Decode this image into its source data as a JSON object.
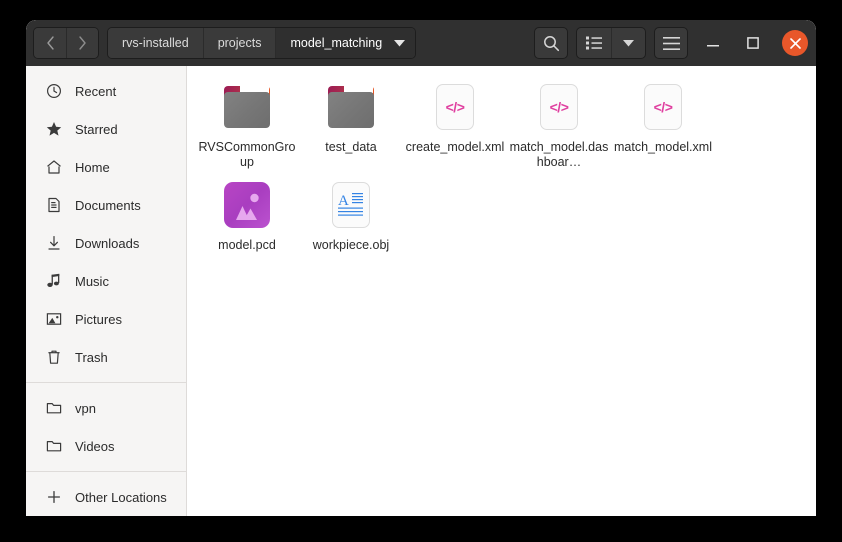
{
  "window": {
    "header": {
      "nav": [
        {
          "name": "back-button",
          "glyph": "‹"
        },
        {
          "name": "forward-button",
          "glyph": "›"
        }
      ],
      "breadcrumbs": [
        {
          "label": "rvs-installed",
          "active": false
        },
        {
          "label": "projects",
          "active": false
        },
        {
          "label": "model_matching",
          "active": true
        }
      ],
      "tools": [
        {
          "name": "search-button",
          "icon": "search-icon"
        },
        {
          "name": "view-options-button",
          "icon": "list-view-icon"
        },
        {
          "name": "view-options-dropdown",
          "icon": "chevron-down-icon"
        },
        {
          "name": "main-menu-button",
          "icon": "hamburger-icon"
        }
      ],
      "window_controls": [
        {
          "name": "minimize-button",
          "icon": "minimize-icon"
        },
        {
          "name": "maximize-button",
          "icon": "maximize-icon"
        },
        {
          "name": "close-button",
          "icon": "close-icon"
        }
      ]
    },
    "sidebar": {
      "groups": [
        {
          "items": [
            {
              "label": "Recent",
              "icon": "clock-icon"
            },
            {
              "label": "Starred",
              "icon": "star-icon"
            },
            {
              "label": "Home",
              "icon": "home-icon"
            },
            {
              "label": "Documents",
              "icon": "documents-icon"
            },
            {
              "label": "Downloads",
              "icon": "download-icon"
            },
            {
              "label": "Music",
              "icon": "music-icon"
            },
            {
              "label": "Pictures",
              "icon": "pictures-icon"
            },
            {
              "label": "Trash",
              "icon": "trash-icon"
            }
          ]
        },
        {
          "items": [
            {
              "label": "vpn",
              "icon": "folder-icon"
            },
            {
              "label": "Videos",
              "icon": "folder-icon"
            }
          ]
        },
        {
          "items": [
            {
              "label": "Other Locations",
              "icon": "plus-icon"
            }
          ]
        }
      ]
    },
    "files": [
      {
        "label": "RVSCommonGroup",
        "type": "folder",
        "icon": "folder-icon"
      },
      {
        "label": "test_data",
        "type": "folder",
        "icon": "folder-icon"
      },
      {
        "label": "create_model.xml",
        "type": "xml",
        "icon": "xml-file-icon",
        "glyph": "</>"
      },
      {
        "label": "match_model.dashboar…",
        "type": "xml",
        "icon": "xml-file-icon",
        "glyph": "</>"
      },
      {
        "label": "match_model.xml",
        "type": "xml",
        "icon": "xml-file-icon",
        "glyph": "</>"
      },
      {
        "label": "model.pcd",
        "type": "image",
        "icon": "image-file-icon"
      },
      {
        "label": "workpiece.obj",
        "type": "text",
        "icon": "text-file-icon"
      }
    ]
  },
  "colors": {
    "header_bg": "#303030",
    "sidebar_bg": "#f6f5f4",
    "content_bg": "#ffffff",
    "close_button": "#e8572a",
    "xml_glyph": "#e040a0",
    "folder_accent": "#e95420",
    "image_icon": "#b845c4",
    "text_icon_accent": "#3584e4"
  }
}
